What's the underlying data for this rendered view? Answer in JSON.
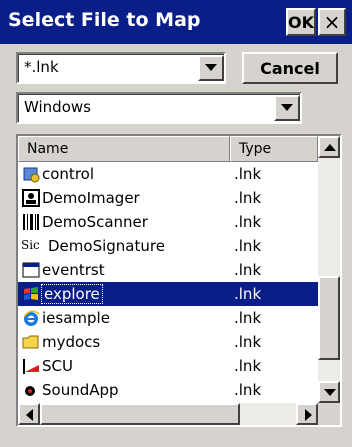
{
  "window": {
    "title": "Select File to Map",
    "ok_label": "OK",
    "close_label": "×"
  },
  "filter": {
    "value": "*.lnk",
    "cancel_label": "Cancel"
  },
  "folder": {
    "value": "Windows"
  },
  "list": {
    "columns": [
      "Name",
      "Type"
    ],
    "items": [
      {
        "name": "control",
        "type": ".lnk",
        "icon": "control-panel-icon"
      },
      {
        "name": "DemoImager",
        "type": ".lnk",
        "icon": "imager-icon"
      },
      {
        "name": "DemoScanner",
        "type": ".lnk",
        "icon": "barcode-icon"
      },
      {
        "name": "DemoSignature",
        "type": ".lnk",
        "icon": "signature-icon",
        "icon_text": "Sic"
      },
      {
        "name": "eventrst",
        "type": ".lnk",
        "icon": "window-app-icon"
      },
      {
        "name": "explore",
        "type": ".lnk",
        "icon": "windows-flag-icon",
        "selected": true
      },
      {
        "name": "iesample",
        "type": ".lnk",
        "icon": "internet-explorer-icon"
      },
      {
        "name": "mydocs",
        "type": ".lnk",
        "icon": "folder-icon"
      },
      {
        "name": "SCU",
        "type": ".lnk",
        "icon": "scu-icon"
      },
      {
        "name": "SoundApp",
        "type": ".lnk",
        "icon": "speaker-icon"
      }
    ]
  },
  "colors": {
    "titlebar": "#0a1e8a",
    "selection": "#0a1e8a",
    "face": "#d6d3ce"
  }
}
